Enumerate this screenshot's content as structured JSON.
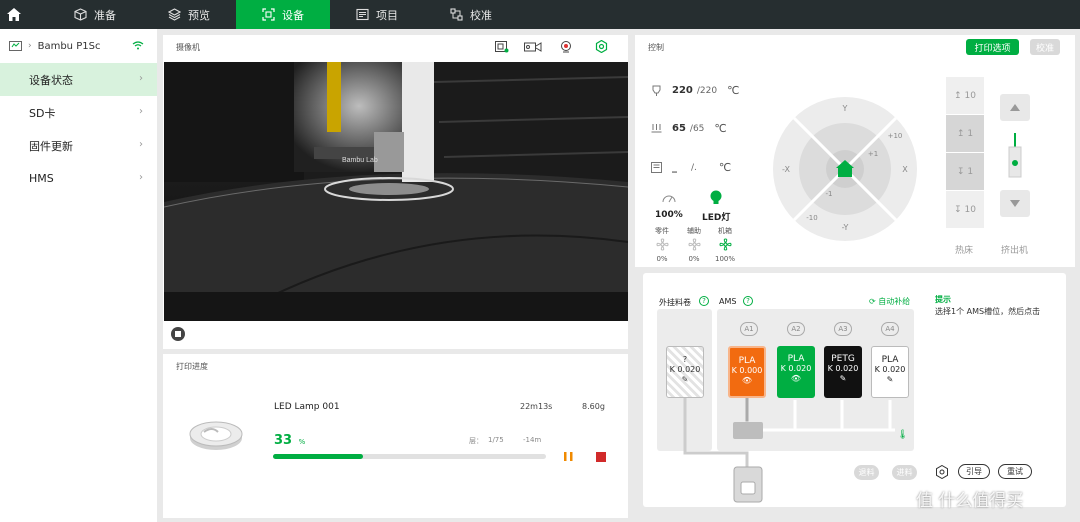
{
  "nav": {
    "tabs": [
      {
        "label": "准备",
        "icon": "cube-icon"
      },
      {
        "label": "预览",
        "icon": "layers-icon"
      },
      {
        "label": "设备",
        "icon": "device-icon"
      },
      {
        "label": "项目",
        "icon": "project-icon"
      },
      {
        "label": "校准",
        "icon": "calibrate-icon"
      }
    ],
    "active": "设备"
  },
  "sidebar": {
    "device_name": "Bambu P1Sc",
    "items": [
      {
        "label": "设备状态"
      },
      {
        "label": "SD卡"
      },
      {
        "label": "固件更新"
      },
      {
        "label": "HMS"
      }
    ]
  },
  "camera": {
    "title": "摄像机",
    "overlay_text": "Bambu Lab"
  },
  "progress": {
    "title": "打印进度",
    "file_name": "LED Lamp 001",
    "time": "22m13s",
    "weight": "8.60g",
    "percent": "33",
    "percent_unit": "%",
    "percent_value": 0.33,
    "layer_label": "层：",
    "layers": "1/75",
    "remaining": "-14m"
  },
  "control": {
    "title": "控制",
    "print_options_label": "打印选项",
    "calibrate_label": "校准",
    "nozzle": {
      "current": "220",
      "target": "/220",
      "unit": "℃"
    },
    "bed": {
      "current": "65",
      "target": "/65",
      "unit": "℃"
    },
    "chamber": {
      "current": "_",
      "target": "/.",
      "unit": "℃"
    },
    "speed": "100%",
    "led": "LED灯",
    "fans": [
      {
        "label": "零件",
        "value": "0%"
      },
      {
        "label": "辅助",
        "value": "0%"
      },
      {
        "label": "机箱",
        "value": "100%"
      }
    ],
    "jog": {
      "y_plus": "Y",
      "y_minus": "-Y",
      "x_plus": "X",
      "x_minus": "-X",
      "plus10": "+10",
      "plus1": "+1",
      "minus1": "-1",
      "minus10": "-10"
    },
    "bed_steps": [
      "10",
      "1",
      "1",
      "10"
    ],
    "bed_label": "热床",
    "extruder_label": "挤出机"
  },
  "ams": {
    "external_label": "外挂料卷",
    "ams_label": "AMS",
    "auto_refill": "自动补给",
    "tip_title": "提示",
    "tip_text": "选择1个 AMS槽位，然后点击",
    "external_slot": {
      "name": "?",
      "k": "K 0.020"
    },
    "slots": [
      {
        "id": "A1",
        "name": "PLA",
        "k": "K 0.000",
        "color": "#f26b10",
        "text": "#ffffff"
      },
      {
        "id": "A2",
        "name": "PLA",
        "k": "K 0.020",
        "color": "#00ae42",
        "text": "#ffffff"
      },
      {
        "id": "A3",
        "name": "PETG",
        "k": "K 0.020",
        "color": "#111111",
        "text": "#ffffff"
      },
      {
        "id": "A4",
        "name": "PLA",
        "k": "K 0.020",
        "color": "#ffffff",
        "text": "#222222"
      }
    ],
    "unload": "退料",
    "load": "进料",
    "guide": "引导",
    "retry": "重试"
  },
  "watermark": "值 什么值得买",
  "colors": {
    "accent": "#00ae42",
    "nav_bg": "#262e30"
  }
}
